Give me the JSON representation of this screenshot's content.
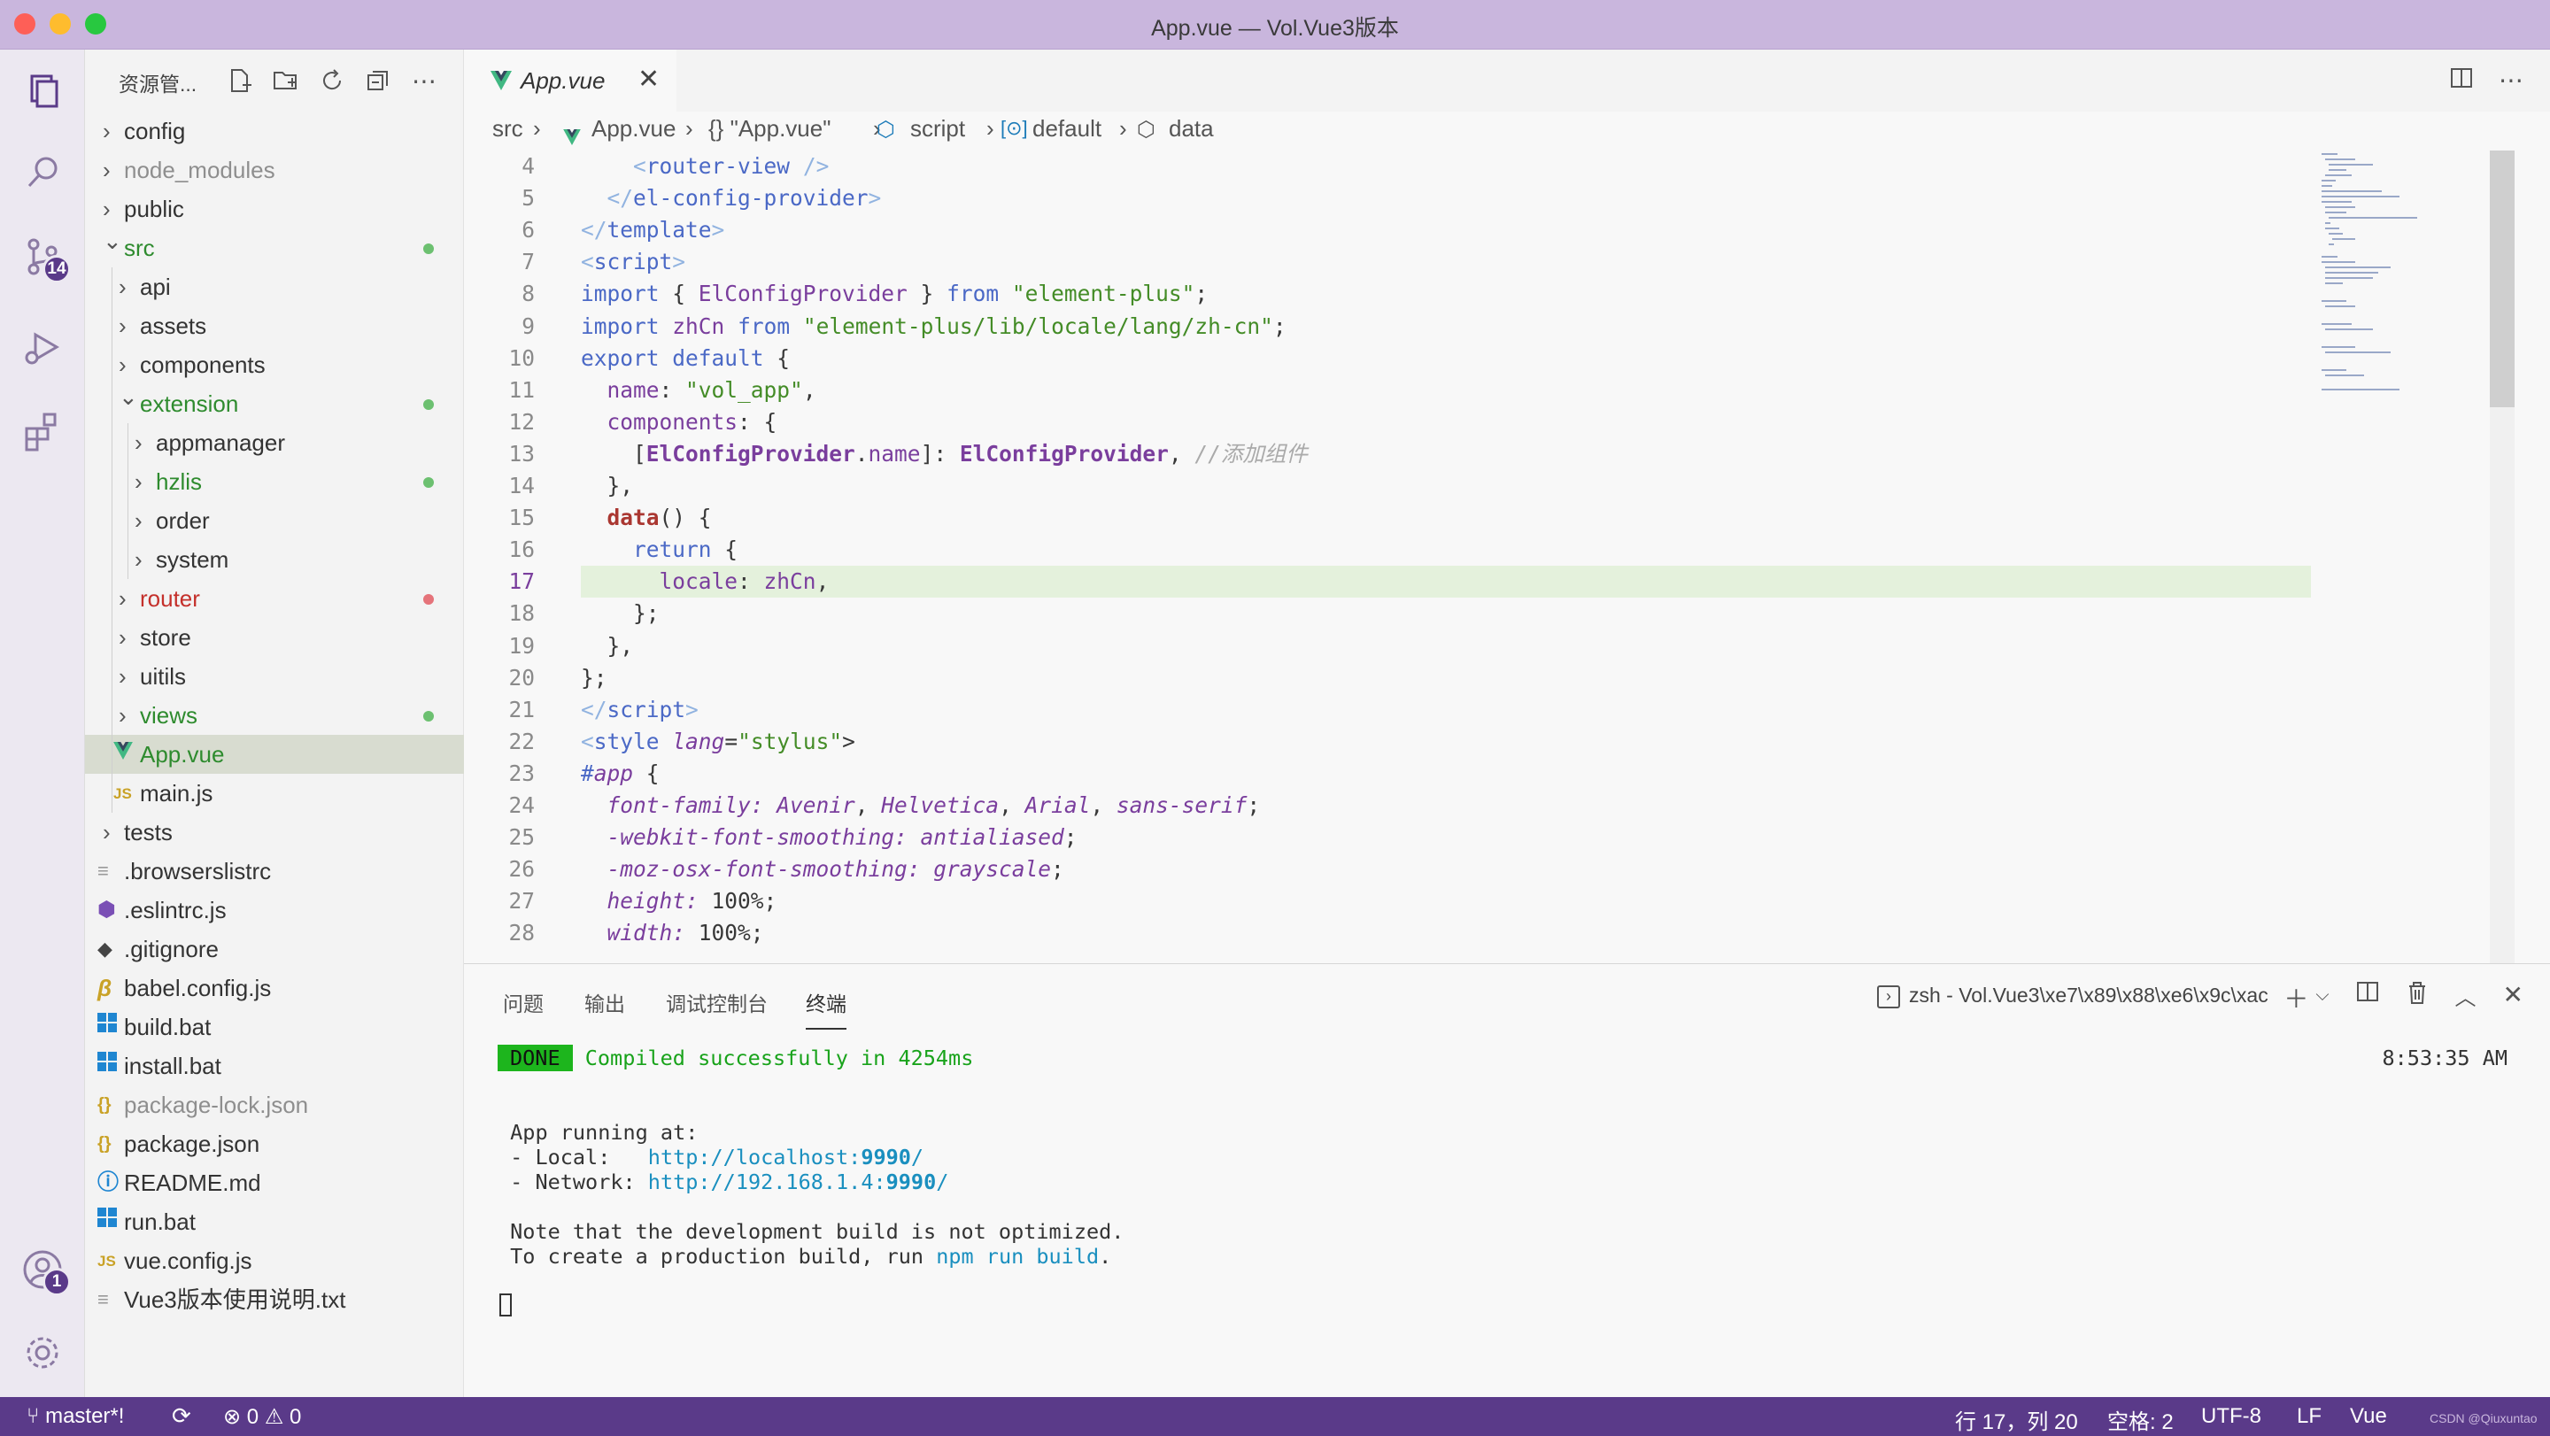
{
  "window": {
    "title": "App.vue — Vol.Vue3版本"
  },
  "activity": {
    "scm_badge": "14",
    "account_badge": "1"
  },
  "sidebar": {
    "title": "资源管...",
    "tree": [
      {
        "label": "config",
        "depth": 0,
        "type": "folder",
        "open": false,
        "color": "#333",
        "dot": ""
      },
      {
        "label": "node_modules",
        "depth": 0,
        "type": "folder",
        "open": false,
        "color": "#8e8e8e",
        "dot": ""
      },
      {
        "label": "public",
        "depth": 0,
        "type": "folder",
        "open": false,
        "color": "#333",
        "dot": ""
      },
      {
        "label": "src",
        "depth": 0,
        "type": "folder",
        "open": true,
        "color": "#2e8b2e",
        "dot": "#6cc070"
      },
      {
        "label": "api",
        "depth": 1,
        "type": "folder",
        "open": false,
        "color": "#333",
        "dot": ""
      },
      {
        "label": "assets",
        "depth": 1,
        "type": "folder",
        "open": false,
        "color": "#333",
        "dot": ""
      },
      {
        "label": "components",
        "depth": 1,
        "type": "folder",
        "open": false,
        "color": "#333",
        "dot": ""
      },
      {
        "label": "extension",
        "depth": 1,
        "type": "folder",
        "open": true,
        "color": "#2e8b2e",
        "dot": "#6cc070"
      },
      {
        "label": "appmanager",
        "depth": 2,
        "type": "folder",
        "open": false,
        "color": "#333",
        "dot": ""
      },
      {
        "label": "hzlis",
        "depth": 2,
        "type": "folder",
        "open": false,
        "color": "#2e8b2e",
        "dot": "#6cc070"
      },
      {
        "label": "order",
        "depth": 2,
        "type": "folder",
        "open": false,
        "color": "#333",
        "dot": ""
      },
      {
        "label": "system",
        "depth": 2,
        "type": "folder",
        "open": false,
        "color": "#333",
        "dot": ""
      },
      {
        "label": "router",
        "depth": 1,
        "type": "folder",
        "open": false,
        "color": "#c4302b",
        "dot": "#e5737a"
      },
      {
        "label": "store",
        "depth": 1,
        "type": "folder",
        "open": false,
        "color": "#333",
        "dot": ""
      },
      {
        "label": "uitils",
        "depth": 1,
        "type": "folder",
        "open": false,
        "color": "#333",
        "dot": ""
      },
      {
        "label": "views",
        "depth": 1,
        "type": "folder",
        "open": false,
        "color": "#2e8b2e",
        "dot": "#6cc070"
      },
      {
        "label": "App.vue",
        "depth": 1,
        "type": "vue",
        "open": false,
        "color": "#2e8b2e",
        "dot": "",
        "selected": true
      },
      {
        "label": "main.js",
        "depth": 1,
        "type": "js",
        "open": false,
        "color": "#333",
        "dot": ""
      },
      {
        "label": "tests",
        "depth": 0,
        "type": "folder",
        "open": false,
        "color": "#333",
        "dot": ""
      },
      {
        "label": ".browserslistrc",
        "depth": 0,
        "type": "lines",
        "open": false,
        "color": "#333",
        "dot": ""
      },
      {
        "label": ".eslintrc.js",
        "depth": 0,
        "type": "eslint",
        "open": false,
        "color": "#333",
        "dot": ""
      },
      {
        "label": ".gitignore",
        "depth": 0,
        "type": "git",
        "open": false,
        "color": "#333",
        "dot": ""
      },
      {
        "label": "babel.config.js",
        "depth": 0,
        "type": "babel",
        "open": false,
        "color": "#333",
        "dot": ""
      },
      {
        "label": "build.bat",
        "depth": 0,
        "type": "win",
        "open": false,
        "color": "#333",
        "dot": ""
      },
      {
        "label": "install.bat",
        "depth": 0,
        "type": "win",
        "open": false,
        "color": "#333",
        "dot": ""
      },
      {
        "label": "package-lock.json",
        "depth": 0,
        "type": "json",
        "open": false,
        "color": "#8e8e8e",
        "dot": ""
      },
      {
        "label": "package.json",
        "depth": 0,
        "type": "json",
        "open": false,
        "color": "#333",
        "dot": ""
      },
      {
        "label": "README.md",
        "depth": 0,
        "type": "info",
        "open": false,
        "color": "#333",
        "dot": ""
      },
      {
        "label": "run.bat",
        "depth": 0,
        "type": "win",
        "open": false,
        "color": "#333",
        "dot": ""
      },
      {
        "label": "vue.config.js",
        "depth": 0,
        "type": "js",
        "open": false,
        "color": "#333",
        "dot": ""
      },
      {
        "label": "Vue3版本使用说明.txt",
        "depth": 0,
        "type": "lines",
        "open": false,
        "color": "#333",
        "dot": ""
      }
    ]
  },
  "editor": {
    "tab": {
      "label": "App.vue",
      "close": "✕"
    },
    "breadcrumb": [
      "src",
      "App.vue",
      "{} \"App.vue\"",
      "script",
      "default",
      "data"
    ],
    "current_line": 17,
    "lines": [
      {
        "n": "4",
        "html": "    <span class='tagc'>&lt;</span><span class='tag'>router-view</span> <span class='tagc'>/&gt;</span>"
      },
      {
        "n": "5",
        "html": "  <span class='tagc'>&lt;/</span><span class='tag'>el-config-provider</span><span class='tagc'>&gt;</span>"
      },
      {
        "n": "6",
        "html": "<span class='tagc'>&lt;/</span><span class='tag'>template</span><span class='tagc'>&gt;</span>"
      },
      {
        "n": "7",
        "html": "<span class='tagc'>&lt;</span><span class='tag'>script</span><span class='tagc'>&gt;</span>"
      },
      {
        "n": "8",
        "html": "<span class='kw'>import</span> { <span class='prop'>ElConfigProvider</span> } <span class='kw'>from</span> <span class='str'>\"element-plus\"</span>;"
      },
      {
        "n": "9",
        "html": "<span class='kw'>import</span> <span class='prop'>zhCn</span> <span class='kw'>from</span> <span class='str'>\"element-plus/lib/locale/lang/zh-cn\"</span>;"
      },
      {
        "n": "10",
        "html": "<span class='kw'>export</span> <span class='kw'>default</span> {"
      },
      {
        "n": "11",
        "html": "  <span class='prop'>name</span>: <span class='str'>\"vol_app\"</span>,"
      },
      {
        "n": "12",
        "html": "  <span class='prop'>components</span>: {"
      },
      {
        "n": "13",
        "html": "    [<span class='bold'>ElConfigProvider</span>.<span class='prop'>name</span>]: <span class='bold'>ElConfigProvider</span>, <span class='cm'>//添加组件</span>"
      },
      {
        "n": "14",
        "html": "  },"
      },
      {
        "n": "15",
        "html": "  <span class='fn'>data</span>() {"
      },
      {
        "n": "16",
        "html": "    <span class='kw'>return</span> {"
      },
      {
        "n": "17",
        "html": "      <span class='prop'>locale</span>: <span class='prop'>zhCn</span>,"
      },
      {
        "n": "18",
        "html": "    };"
      },
      {
        "n": "19",
        "html": "  },"
      },
      {
        "n": "20",
        "html": "};"
      },
      {
        "n": "21",
        "html": "<span class='tagc'>&lt;/</span><span class='tag'>script</span><span class='tagc'>&gt;</span>"
      },
      {
        "n": "22",
        "html": "<span class='tagc'>&lt;</span><span class='tag'>style</span> <span class='it'>lang</span>=<span class='str'>\"stylus\"</span>&gt;"
      },
      {
        "n": "23",
        "html": "<span class='kw'>#</span><span class='it'>app</span> {"
      },
      {
        "n": "24",
        "html": "  <span class='it'>font-family: Avenir</span>, <span class='it'>Helvetica</span>, <span class='it'>Arial</span>, <span class='it'>sans-serif</span>;"
      },
      {
        "n": "25",
        "html": "  <span class='it'>-webkit-font-smoothing: antialiased</span>;"
      },
      {
        "n": "26",
        "html": "  <span class='it'>-moz-osx-font-smoothing: grayscale</span>;"
      },
      {
        "n": "27",
        "html": "  <span class='it'>height:</span> 100%;"
      },
      {
        "n": "28",
        "html": "  <span class='it'>width:</span> 100%;"
      }
    ]
  },
  "panel": {
    "tabs": [
      "问题",
      "输出",
      "调试控制台",
      "终端"
    ],
    "active_tab": 3,
    "terminal_selector": "zsh - Vol.Vue3\\xe7\\x89\\x88\\xe6\\x9c\\xac",
    "done_label": "DONE",
    "compiled_msg": "Compiled successfully in 4254ms",
    "time": "8:53:35 AM",
    "running_at": "App running at:",
    "local_label": "- Local:   ",
    "local_url_prefix": "http://localhost:",
    "local_port": "9990",
    "local_url_suffix": "/",
    "network_label": "- Network: ",
    "network_url_prefix": "http://192.168.1.4:",
    "network_port": "9990",
    "network_url_suffix": "/",
    "note": "Note that the development build is not optimized.",
    "prod_prefix": "To create a production build, run ",
    "prod_cmd": "npm run build",
    "prod_suffix": "."
  },
  "statusbar": {
    "branch": "master*!",
    "errors": "0",
    "warnings": "0",
    "position": "行 17，列 20",
    "spaces": "空格: 2",
    "encoding": "UTF-8",
    "eol": "LF",
    "language": "Vue",
    "watermark": "CSDN @Qiuxuntao"
  },
  "colors": {
    "accent": "#5a3a89",
    "titlebar": "#c9b6dd",
    "git_added": "#6cc070",
    "git_modified": "#e5737a"
  }
}
